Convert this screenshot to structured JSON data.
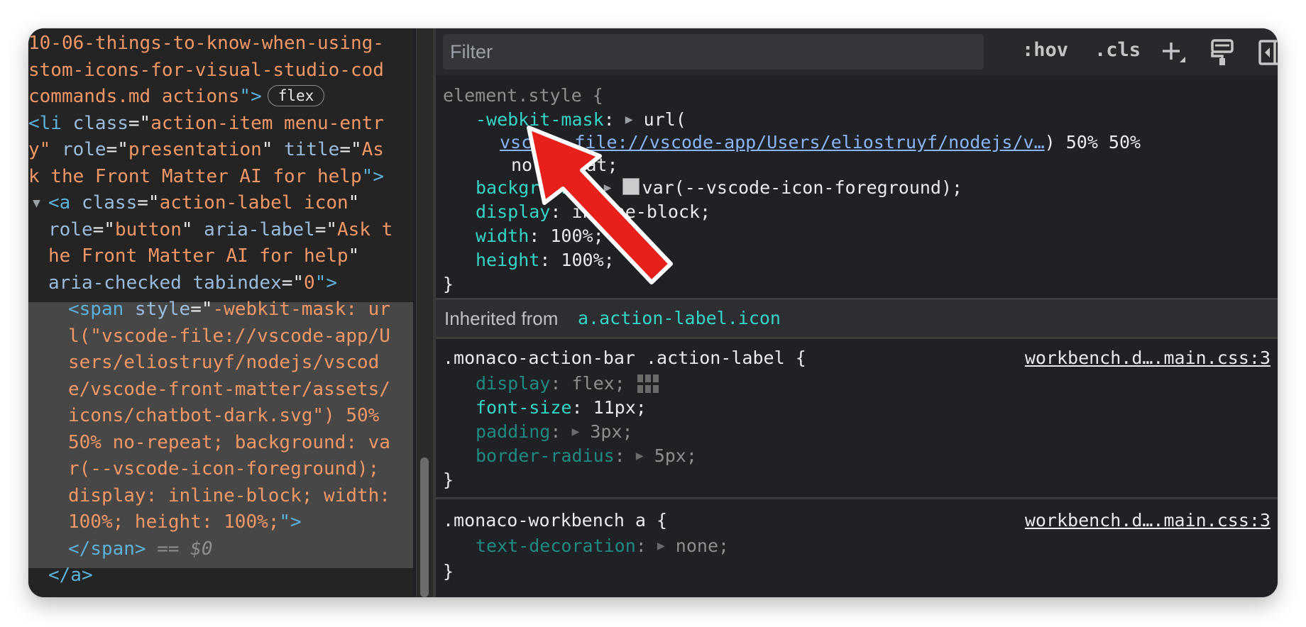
{
  "elements_panel": {
    "lines": [
      {
        "parts": [
          {
            "t": "10-06-things-to-know-when-using-",
            "c": "val"
          }
        ]
      },
      {
        "parts": [
          {
            "t": "stom-icons-for-visual-studio-cod",
            "c": "val"
          }
        ]
      },
      {
        "parts": [
          {
            "t": "commands.md actions",
            "c": "val"
          },
          {
            "t": "\">",
            "c": "tag"
          }
        ],
        "badge": "flex"
      },
      {
        "parts": [
          {
            "t": "<li ",
            "c": "tag"
          },
          {
            "t": "class",
            "c": "attr"
          },
          {
            "t": "=\"",
            "c": "pun"
          },
          {
            "t": "action-item menu-entr",
            "c": "val"
          }
        ]
      },
      {
        "parts": [
          {
            "t": "y\" ",
            "c": "val"
          },
          {
            "t": "role",
            "c": "attr"
          },
          {
            "t": "=\"",
            "c": "pun"
          },
          {
            "t": "presentation",
            "c": "val"
          },
          {
            "t": "\" ",
            "c": "pun"
          },
          {
            "t": "title",
            "c": "attr"
          },
          {
            "t": "=\"",
            "c": "pun"
          },
          {
            "t": "As",
            "c": "val"
          }
        ]
      },
      {
        "parts": [
          {
            "t": "k the Front Matter AI for help",
            "c": "val"
          },
          {
            "t": "\">",
            "c": "tag"
          }
        ]
      },
      {
        "parts": [
          {
            "t": "<a ",
            "c": "tag"
          },
          {
            "t": "class",
            "c": "attr"
          },
          {
            "t": "=\"",
            "c": "pun"
          },
          {
            "t": "action-label icon",
            "c": "val"
          },
          {
            "t": "\"",
            "c": "pun"
          }
        ],
        "expand": true
      },
      {
        "parts": [
          {
            "t": "role",
            "c": "attr"
          },
          {
            "t": "=\"",
            "c": "pun"
          },
          {
            "t": "button",
            "c": "val"
          },
          {
            "t": "\" ",
            "c": "pun"
          },
          {
            "t": "aria-label",
            "c": "attr"
          },
          {
            "t": "=\"",
            "c": "pun"
          },
          {
            "t": "Ask t",
            "c": "val"
          }
        ],
        "indent": 1
      },
      {
        "parts": [
          {
            "t": "he Front Matter AI for help",
            "c": "val"
          },
          {
            "t": "\"",
            "c": "pun"
          }
        ],
        "indent": 1
      },
      {
        "parts": [
          {
            "t": "aria-checked ",
            "c": "attr"
          },
          {
            "t": "tabindex",
            "c": "attr"
          },
          {
            "t": "=\"",
            "c": "pun"
          },
          {
            "t": "0",
            "c": "val"
          },
          {
            "t": "\">",
            "c": "tag"
          }
        ],
        "indent": 1
      },
      {
        "parts": [
          {
            "t": "<span ",
            "c": "tag"
          },
          {
            "t": "style",
            "c": "attr"
          },
          {
            "t": "=\"",
            "c": "pun"
          },
          {
            "t": "-webkit-mask: ur",
            "c": "val"
          }
        ],
        "indent": 2
      },
      {
        "parts": [
          {
            "t": "l(\"vscode-file://vscode-app/U",
            "c": "val"
          }
        ],
        "indent": 2
      },
      {
        "parts": [
          {
            "t": "sers/eliostruyf/nodejs/vscod",
            "c": "val"
          }
        ],
        "indent": 2
      },
      {
        "parts": [
          {
            "t": "e/vscode-front-matter/assets/",
            "c": "val"
          }
        ],
        "indent": 2
      },
      {
        "parts": [
          {
            "t": "icons/chatbot-dark.svg\") 50%",
            "c": "val"
          }
        ],
        "indent": 2
      },
      {
        "parts": [
          {
            "t": "50% no-repeat; background: va",
            "c": "val"
          }
        ],
        "indent": 2
      },
      {
        "parts": [
          {
            "t": "r(--vscode-icon-foreground);",
            "c": "val"
          }
        ],
        "indent": 2
      },
      {
        "parts": [
          {
            "t": "display: inline-block; width:",
            "c": "val"
          }
        ],
        "indent": 2
      },
      {
        "parts": [
          {
            "t": "100%; height: 100%;",
            "c": "val"
          },
          {
            "t": "\">",
            "c": "tag"
          }
        ],
        "indent": 2
      },
      {
        "parts": [
          {
            "t": "</span>",
            "c": "tag"
          },
          {
            "t": " == ",
            "c": "dim"
          },
          {
            "t": "$0",
            "c": "em"
          }
        ],
        "indent": 2
      },
      {
        "parts": [
          {
            "t": "</a>",
            "c": "tag"
          }
        ],
        "indent": 1
      }
    ]
  },
  "toolbar": {
    "filter_placeholder": "Filter",
    "hov_label": ":hov",
    "cls_label": ".cls",
    "icons": [
      "add-icon",
      "paint-brush-icon",
      "toggle-sidebar-icon"
    ]
  },
  "element_style": {
    "selector": "element.style {",
    "mask_prop": "-webkit-mask",
    "mask_url_open": "url(",
    "mask_url_link": "vscode-file://vscode-app/Users/eliostruyf/nodejs/v…",
    "mask_url_rest": ") 50% 50%",
    "mask_cont": "no-repeat;",
    "bg_prop": "background",
    "bg_value": "var(--vscode-icon-foreground);",
    "display_prop": "display",
    "display_value": "inline-block;",
    "width_prop": "width",
    "width_value": "100%;",
    "height_prop": "height",
    "height_value": "100%;",
    "close": "}"
  },
  "inherited": {
    "label": "Inherited from",
    "selector": "a.action-label.icon"
  },
  "rules": [
    {
      "selector": ".monaco-action-bar .action-label {",
      "source": "workbench.d….main.css:3",
      "close": "}",
      "decls": [
        {
          "prop": "display",
          "value": "flex;",
          "inactive": true,
          "grid": true
        },
        {
          "prop": "font-size",
          "value": "11px;",
          "inactive": false
        },
        {
          "prop": "padding",
          "value": "3px;",
          "inactive": true,
          "expand": true
        },
        {
          "prop": "border-radius",
          "value": "5px;",
          "inactive": true,
          "expand": true
        }
      ]
    },
    {
      "selector": ".monaco-workbench a {",
      "source": "workbench.d….main.css:3",
      "close": "}",
      "decls": [
        {
          "prop": "text-decoration",
          "value": "none;",
          "inactive": true,
          "expand": true
        }
      ]
    }
  ],
  "colors": {
    "arrow": "#e8201b",
    "property": "#35d4c7",
    "value_string": "#f29766",
    "tag": "#5db0d7"
  }
}
